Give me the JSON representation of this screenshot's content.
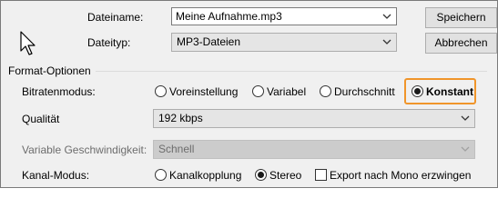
{
  "file": {
    "filename_label": "Dateiname:",
    "filename_value": "Meine Aufnahme.mp3",
    "filetype_label": "Dateityp:",
    "filetype_value": "MP3-Dateien",
    "save_label": "Speichern",
    "cancel_label": "Abbrechen"
  },
  "format": {
    "group_title": "Format-Optionen",
    "bitrate_mode_label": "Bitratenmodus:",
    "bitrate_modes": [
      "Voreinstellung",
      "Variabel",
      "Durchschnitt",
      "Konstant"
    ],
    "bitrate_mode_selected": "Konstant",
    "quality_label": "Qualität",
    "quality_value": "192 kbps",
    "variable_speed_label": "Variable Geschwindigkeit:",
    "variable_speed_value": "Schnell",
    "channel_mode_label": "Kanal-Modus:",
    "channel_modes": [
      "Kanalkopplung",
      "Stereo"
    ],
    "channel_mode_selected": "Stereo",
    "mono_export_label": "Export nach Mono erzwingen",
    "mono_export_checked": false
  },
  "colors": {
    "highlight": "#f0952a",
    "window_bg": "#f0f0f0"
  },
  "icons": {
    "pointer": "mouse-cursor-icon",
    "dropdown": "chevron-down-icon"
  }
}
